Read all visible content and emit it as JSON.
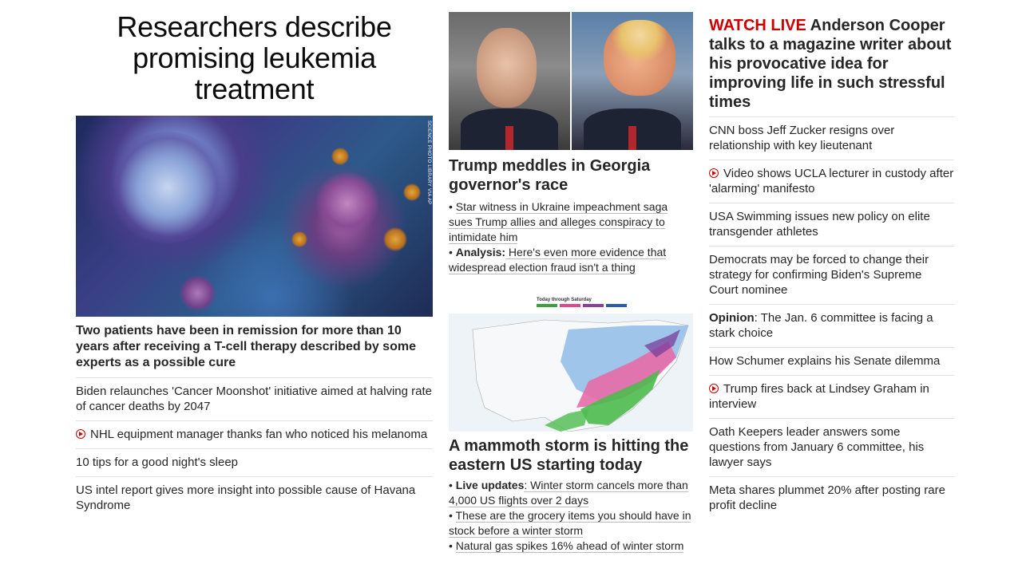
{
  "col1": {
    "title": "Researchers describe promising leukemia treatment",
    "image_credit": "SCIENCE PHOTO LIBRARY VIA AP",
    "lede": "Two patients have been in remission for more than 10 years after receiving a T-cell therapy described by some experts as a possible cure",
    "headlines": [
      {
        "text": "Biden relaunches 'Cancer Moonshot' initiative aimed at halving rate of cancer deaths by 2047",
        "video": false
      },
      {
        "text": "NHL equipment manager thanks fan who noticed his melanoma",
        "video": true
      },
      {
        "text": "10 tips for a good night's sleep",
        "video": false
      },
      {
        "text": "US intel report gives more insight into possible cause of Havana Syndrome",
        "video": false
      }
    ]
  },
  "col2": {
    "story1": {
      "headline": "Trump meddles in Georgia governor's race",
      "bullets": [
        {
          "bold": "",
          "text": "Star witness in Ukraine impeachment saga sues Trump allies and alleges conspiracy to intimidate him"
        },
        {
          "bold": "Analysis:",
          "text": " Here's even more evidence that widespread election fraud isn't a thing"
        }
      ]
    },
    "map_legend_title": "Today through Saturday",
    "map_legend_colors": [
      "#3aa23a",
      "#e0488e",
      "#8a3ea0",
      "#2a5db0"
    ],
    "story2": {
      "headline": "A mammoth storm is hitting the eastern US starting today",
      "bullets": [
        {
          "bold": "Live updates",
          "text": ": Winter storm cancels more than 4,000 US flights over 2 days"
        },
        {
          "bold": "",
          "text": "These are the grocery items you should have in stock before a winter storm"
        },
        {
          "bold": "",
          "text": "Natural gas spikes 16% ahead of winter storm"
        }
      ]
    }
  },
  "col3": {
    "watch_live": "WATCH LIVE",
    "watch_text": " Anderson Cooper talks to a magazine writer about his provocative idea for improving life in such stressful times",
    "headlines": [
      {
        "bold": "",
        "text": "CNN boss Jeff Zucker resigns over relationship with key lieutenant",
        "video": false
      },
      {
        "bold": "",
        "text": "Video shows UCLA lecturer in custody after 'alarming' manifesto",
        "video": true
      },
      {
        "bold": "",
        "text": "USA Swimming issues new policy on elite transgender athletes",
        "video": false
      },
      {
        "bold": "",
        "text": "Democrats may be forced to change their strategy for confirming Biden's Supreme Court nominee",
        "video": false
      },
      {
        "bold": "Opinion",
        "text": ": The Jan. 6 committee is facing a stark choice",
        "video": false
      },
      {
        "bold": "",
        "text": "How Schumer explains his Senate dilemma",
        "video": false
      },
      {
        "bold": "",
        "text": "Trump fires back at Lindsey Graham in interview",
        "video": true
      },
      {
        "bold": "",
        "text": "Oath Keepers leader answers some questions from January 6 committee, his lawyer says",
        "video": false
      },
      {
        "bold": "",
        "text": "Meta shares plummet 20% after posting rare profit decline",
        "video": false
      }
    ]
  }
}
